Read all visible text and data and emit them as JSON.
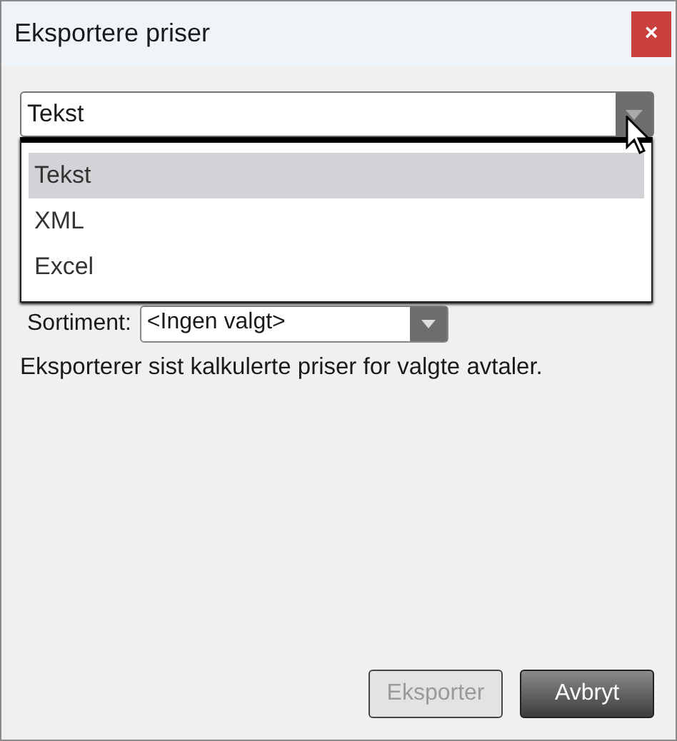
{
  "window": {
    "title": "Eksportere priser",
    "close": "×"
  },
  "format_combo": {
    "value": "Tekst",
    "expanded": true,
    "options": [
      {
        "label": "Tekst",
        "selected": true
      },
      {
        "label": "XML",
        "selected": false
      },
      {
        "label": "Excel",
        "selected": false
      }
    ]
  },
  "sortiment": {
    "label": "Sortiment:",
    "value": "<Ingen valgt>"
  },
  "description": "Eksporterer sist kalkulerte priser for valgte avtaler.",
  "buttons": [
    {
      "label": "Eksporter",
      "disabled": true
    },
    {
      "label": "Avbryt",
      "disabled": false
    }
  ]
}
